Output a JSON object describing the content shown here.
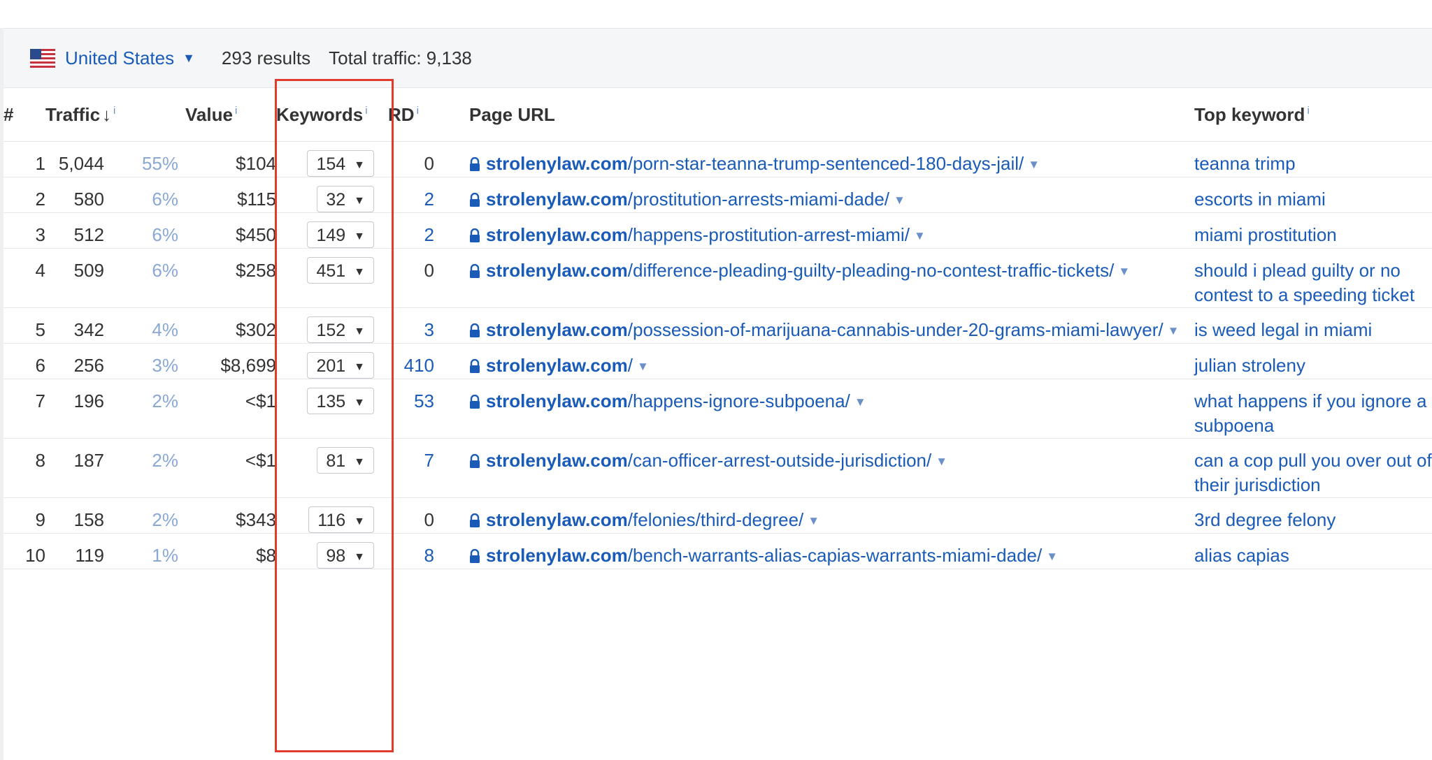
{
  "toolbar": {
    "country": "United States",
    "results": "293 results",
    "total_traffic": "Total traffic: 9,138"
  },
  "columns": {
    "index": "#",
    "traffic": "Traffic",
    "value": "Value",
    "keywords": "Keywords",
    "rd": "RD",
    "page_url": "Page URL",
    "top_keyword": "Top keyword",
    "info_marker": "i"
  },
  "rows": [
    {
      "n": "1",
      "traffic": "5,044",
      "pct": "55%",
      "value": "$104",
      "keywords": "154",
      "rd": "0",
      "domain": "strolenylaw.com",
      "path": "/porn-star-teanna-trump-sentenced-180-days-jail/",
      "top_keyword": "teanna trimp"
    },
    {
      "n": "2",
      "traffic": "580",
      "pct": "6%",
      "value": "$115",
      "keywords": "32",
      "rd": "2",
      "domain": "strolenylaw.com",
      "path": "/prostitution-arrests-miami-dade/",
      "top_keyword": "escorts in miami"
    },
    {
      "n": "3",
      "traffic": "512",
      "pct": "6%",
      "value": "$450",
      "keywords": "149",
      "rd": "2",
      "domain": "strolenylaw.com",
      "path": "/happens-prostitution-arrest-miami/",
      "top_keyword": "miami prostitution"
    },
    {
      "n": "4",
      "traffic": "509",
      "pct": "6%",
      "value": "$258",
      "keywords": "451",
      "rd": "0",
      "domain": "strolenylaw.com",
      "path": "/difference-pleading-guilty-pleading-no-contest-traffic-tickets/",
      "top_keyword": "should i plead guilty or no contest to a speeding ticket"
    },
    {
      "n": "5",
      "traffic": "342",
      "pct": "4%",
      "value": "$302",
      "keywords": "152",
      "rd": "3",
      "domain": "strolenylaw.com",
      "path": "/possession-of-marijuana-cannabis-under-20-grams-miami-lawyer/",
      "top_keyword": "is weed legal in miami"
    },
    {
      "n": "6",
      "traffic": "256",
      "pct": "3%",
      "value": "$8,699",
      "keywords": "201",
      "rd": "410",
      "domain": "strolenylaw.com",
      "path": "/",
      "top_keyword": "julian stroleny"
    },
    {
      "n": "7",
      "traffic": "196",
      "pct": "2%",
      "value": "<$1",
      "keywords": "135",
      "rd": "53",
      "domain": "strolenylaw.com",
      "path": "/happens-ignore-subpoena/",
      "top_keyword": "what happens if you ignore a subpoena"
    },
    {
      "n": "8",
      "traffic": "187",
      "pct": "2%",
      "value": "<$1",
      "keywords": "81",
      "rd": "7",
      "domain": "strolenylaw.com",
      "path": "/can-officer-arrest-outside-jurisdiction/",
      "top_keyword": "can a cop pull you over out of their jurisdiction"
    },
    {
      "n": "9",
      "traffic": "158",
      "pct": "2%",
      "value": "$343",
      "keywords": "116",
      "rd": "0",
      "domain": "strolenylaw.com",
      "path": "/felonies/third-degree/",
      "top_keyword": "3rd degree felony"
    },
    {
      "n": "10",
      "traffic": "119",
      "pct": "1%",
      "value": "$8",
      "keywords": "98",
      "rd": "8",
      "domain": "strolenylaw.com",
      "path": "/bench-warrants-alias-capias-warrants-miami-dade/",
      "top_keyword": "alias capias"
    }
  ],
  "icons": {
    "flag": "us-flag-icon",
    "lock": "lock-icon",
    "caret": "dropdown-caret-icon",
    "sort": "sort-desc-arrow-icon"
  },
  "colors": {
    "link": "#1a5bb8",
    "percent": "#8aa8d4",
    "highlight": "#e23b2e",
    "toolbar_bg": "#f5f6f8"
  }
}
